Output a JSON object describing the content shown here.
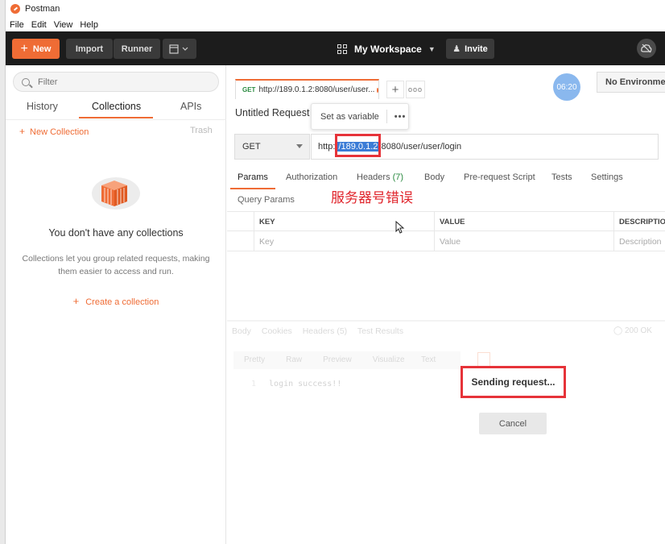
{
  "app": {
    "title": "Postman"
  },
  "menu": [
    "File",
    "Edit",
    "View",
    "Help"
  ],
  "toolbar": {
    "new_label": "New",
    "import_label": "Import",
    "runner_label": "Runner",
    "workspace_label": "My Workspace",
    "invite_label": "Invite"
  },
  "sidebar": {
    "filter_placeholder": "Filter",
    "tabs": [
      "History",
      "Collections",
      "APIs"
    ],
    "new_collection": "New Collection",
    "trash": "Trash",
    "empty_title": "You don't have any collections",
    "empty_desc": "Collections let you group related requests, making them easier to access and run.",
    "create_collection": "Create a collection"
  },
  "request_tab": {
    "method": "GET",
    "title": "http://189.0.1.2:8080/user/user..."
  },
  "timer": "06:20",
  "environment": "No Environment",
  "request": {
    "name": "Untitled Request",
    "popover_set_variable": "Set as variable",
    "popover_more": "•••",
    "method": "GET",
    "url_prefix": "http:/",
    "url_highlight": "/189.0.1.2",
    "url_suffix": ":8080/user/user/login"
  },
  "request_tabs": {
    "params": "Params",
    "authorization": "Authorization",
    "headers": "Headers",
    "headers_count": "(7)",
    "body": "Body",
    "pre_request": "Pre-request Script",
    "tests": "Tests",
    "settings": "Settings"
  },
  "annotation": "服务器号错误",
  "query_params": {
    "label": "Query Params",
    "columns": [
      "KEY",
      "VALUE",
      "DESCRIPTION"
    ],
    "placeholders": [
      "Key",
      "Value",
      "Description"
    ]
  },
  "response": {
    "tabs": [
      "Body",
      "Cookies",
      "Headers (5)",
      "Test Results"
    ],
    "status": "200 OK",
    "view_buttons": [
      "Pretty",
      "Raw",
      "Preview",
      "Visualize"
    ],
    "format": "Text",
    "line_number": "1",
    "line_text": "login success!!"
  },
  "overlay": {
    "sending": "Sending request...",
    "cancel": "Cancel"
  },
  "colors": {
    "accent": "#ef6c35",
    "annotation_red": "#e63339",
    "method_green": "#2a8a40"
  }
}
